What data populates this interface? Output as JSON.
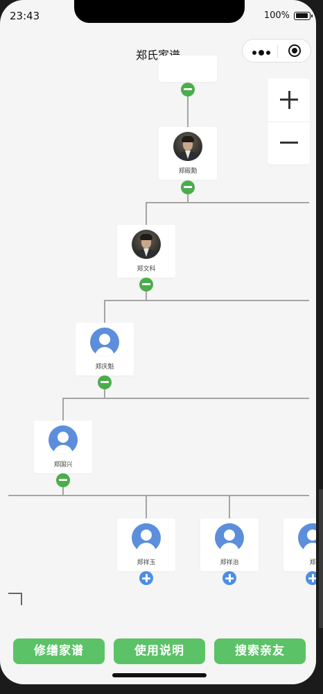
{
  "status_bar": {
    "time": "23:43",
    "battery": "100%"
  },
  "nav": {
    "title": "郑氏家谱"
  },
  "zoom": {
    "in_icon": "plus-icon",
    "out_icon": "minus-icon"
  },
  "tree": {
    "nodes": [
      {
        "name": "郑殿勳",
        "avatar": "photo",
        "toggle": "collapse"
      },
      {
        "name": "郑文科",
        "avatar": "photo",
        "toggle": "collapse"
      },
      {
        "name": "郑庆魁",
        "avatar": "default",
        "toggle": "collapse"
      },
      {
        "name": "郑国兴",
        "avatar": "default",
        "toggle": "collapse"
      },
      {
        "name": "郑祥玉",
        "avatar": "default",
        "toggle": "expand"
      },
      {
        "name": "郑祥治",
        "avatar": "default",
        "toggle": "expand"
      },
      {
        "name": "郑",
        "avatar": "default",
        "toggle": "expand"
      }
    ]
  },
  "actions": {
    "edit": "修缮家谱",
    "help": "使用说明",
    "search": "搜索亲友"
  },
  "colors": {
    "accent_green": "#5cc267",
    "collapse_green": "#4aad4c",
    "expand_blue": "#4d8ee5",
    "avatar_blue": "#5c8edc",
    "background": "#f5f5f5"
  }
}
